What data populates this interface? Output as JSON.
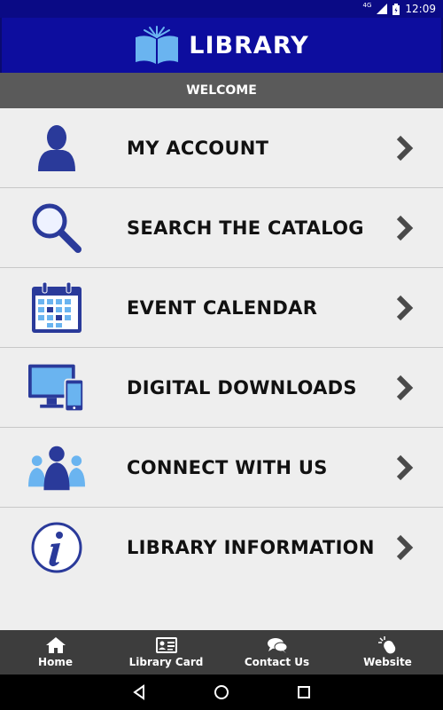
{
  "status_bar": {
    "network": "4G",
    "time": "12:09"
  },
  "header": {
    "title": "LIBRARY",
    "logo_icon": "open-book-icon"
  },
  "welcome": {
    "text": "WELCOME"
  },
  "menu": {
    "items": [
      {
        "label": "MY ACCOUNT",
        "icon": "person-icon"
      },
      {
        "label": "SEARCH THE CATALOG",
        "icon": "magnifier-icon"
      },
      {
        "label": "EVENT CALENDAR",
        "icon": "calendar-icon"
      },
      {
        "label": "DIGITAL DOWNLOADS",
        "icon": "devices-icon"
      },
      {
        "label": "CONNECT WITH US",
        "icon": "group-icon"
      },
      {
        "label": "LIBRARY INFORMATION",
        "icon": "info-icon"
      }
    ]
  },
  "bottom_nav": {
    "items": [
      {
        "label": "Home",
        "icon": "home-icon"
      },
      {
        "label": "Library Card",
        "icon": "id-card-icon"
      },
      {
        "label": "Contact Us",
        "icon": "chat-bubbles-icon"
      },
      {
        "label": "Website",
        "icon": "mouse-click-icon"
      }
    ]
  },
  "colors": {
    "header": "#0d0d9e",
    "accent_blue": "#2a3a9a",
    "light_blue": "#5fa8e0",
    "welcome_bar": "#5a5a5a",
    "bottom_nav": "#3d3d3d"
  }
}
